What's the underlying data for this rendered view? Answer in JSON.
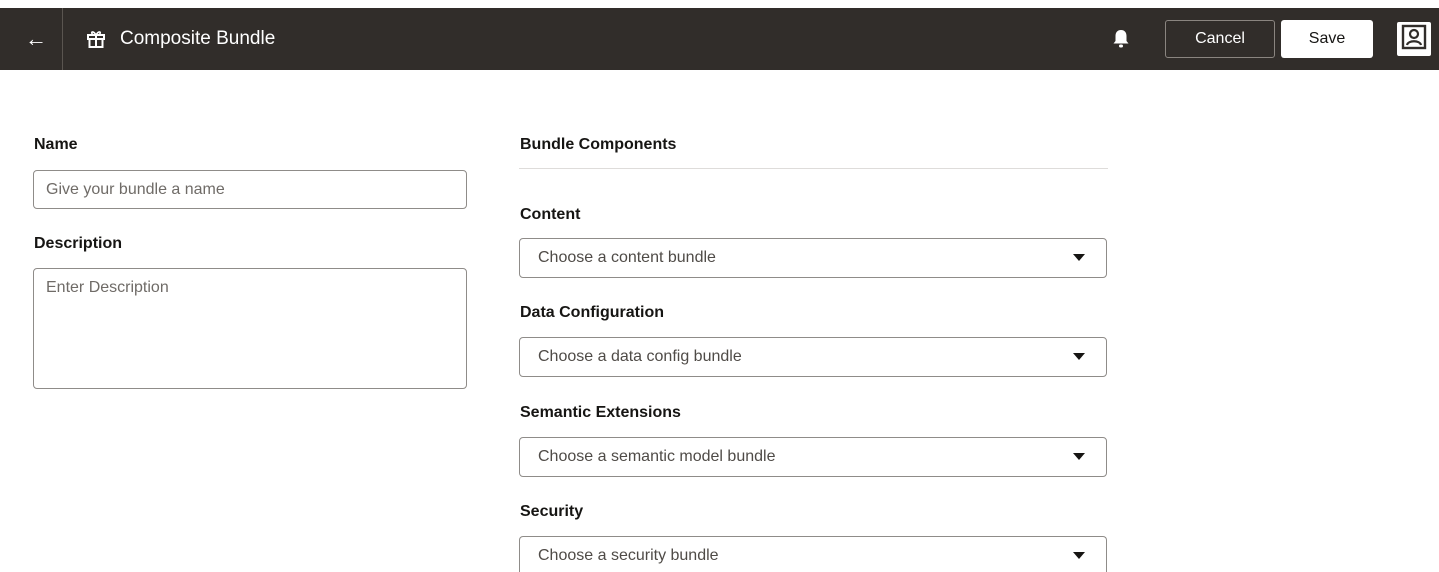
{
  "header": {
    "back_icon": "arrow-left-icon",
    "bundle_icon": "gift-icon",
    "title": "Composite Bundle",
    "notification_icon": "bell-icon",
    "cancel_label": "Cancel",
    "save_label": "Save",
    "user_icon": "user-avatar-icon"
  },
  "form": {
    "name_label": "Name",
    "name_placeholder": "Give your bundle a name",
    "name_value": "",
    "description_label": "Description",
    "description_placeholder": "Enter Description",
    "description_value": ""
  },
  "components": {
    "heading": "Bundle Components",
    "content": {
      "label": "Content",
      "placeholder": "Choose a content bundle"
    },
    "data_configuration": {
      "label": "Data Configuration",
      "placeholder": "Choose a data config bundle"
    },
    "semantic_extensions": {
      "label": "Semantic Extensions",
      "placeholder": "Choose a semantic model bundle"
    },
    "security": {
      "label": "Security",
      "placeholder": "Choose a security bundle"
    }
  },
  "colors": {
    "header_bg": "#312d2a",
    "header_text": "#ffffff",
    "border": "#8f8c89",
    "text": "#161513"
  }
}
